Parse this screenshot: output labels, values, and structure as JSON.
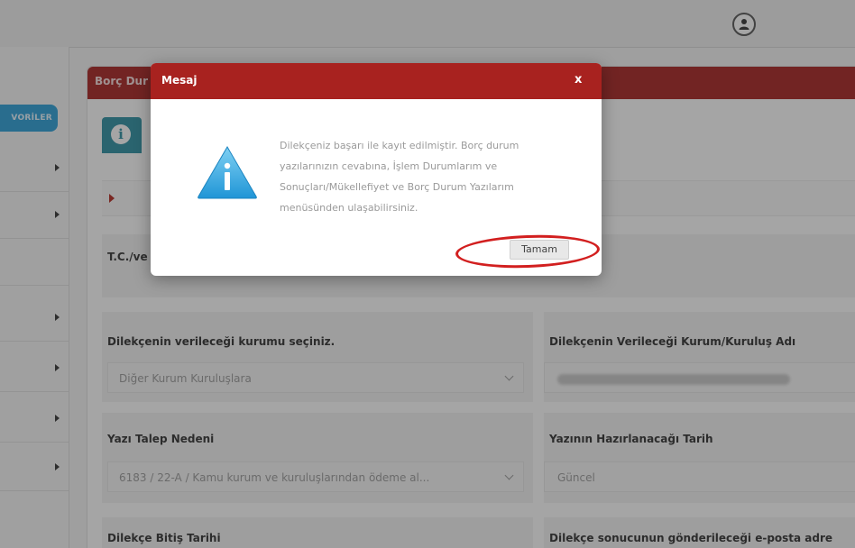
{
  "sidebar": {
    "favorites_label": "VORİLER"
  },
  "panel": {
    "title": "Borç Dur",
    "tc_label": "T.C./ve"
  },
  "form": {
    "institution_label": "Dilekçenin verileceği kurumu seçiniz.",
    "institution_value": "Diğer Kurum Kuruluşlara",
    "institution_name_label": "Dilekçenin Verileceği Kurum/Kuruluş Adı",
    "reason_label": "Yazı Talep Nedeni",
    "reason_value": "6183 / 22-A / Kamu kurum ve kuruluşlarından ödeme al...",
    "prep_date_label": "Yazının Hazırlanacağı Tarih",
    "prep_date_value": "Güncel",
    "end_date_label": "Dilekçe Bitiş Tarihi",
    "email_label": "Dilekçe sonucunun gönderileceği e-posta adre"
  },
  "modal": {
    "title": "Mesaj",
    "close": "x",
    "message": "Dilekçeniz başarı ile kayıt edilmiştir. Borç durum yazılarınızın cevabına, İşlem Durumlarım ve Sonuçları/Mükellefiyet ve Borç Durum Yazılarım menüsünden ulaşabilirsiniz.",
    "ok_label": "Tamam"
  },
  "colors": {
    "header_red": "#a8221f",
    "accent_blue": "#2a9fd8",
    "annotation_red": "#d21f1f"
  },
  "icons": {
    "user": "user-icon",
    "info": "info-icon",
    "warning": "warning-info-icon"
  }
}
